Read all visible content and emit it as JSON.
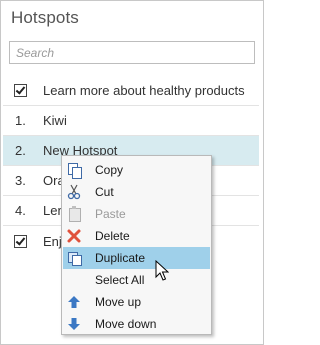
{
  "panel": {
    "title": "Hotspots",
    "search": {
      "placeholder": "Search",
      "value": ""
    }
  },
  "rows": [
    {
      "type": "check",
      "label": "Learn more about healthy products",
      "checked": true
    },
    {
      "type": "item",
      "num": "1.",
      "label": "Kiwi"
    },
    {
      "type": "item",
      "num": "2.",
      "label": "New Hotspot",
      "selected": true
    },
    {
      "type": "item",
      "num": "3.",
      "label": "Ora"
    },
    {
      "type": "item",
      "num": "4.",
      "label": "Len"
    },
    {
      "type": "check",
      "label": "Enjo",
      "checked": true
    }
  ],
  "context_menu": {
    "items": [
      {
        "label": "Copy",
        "icon": "copy-icon",
        "enabled": true
      },
      {
        "label": "Cut",
        "icon": "scissors-icon",
        "enabled": true
      },
      {
        "label": "Paste",
        "icon": "paste-icon",
        "enabled": false
      },
      {
        "label": "Delete",
        "icon": "delete-x-icon",
        "enabled": true
      },
      {
        "label": "Duplicate",
        "icon": "duplicate-icon",
        "enabled": true,
        "highlighted": true
      },
      {
        "label": "Select All",
        "icon": "",
        "enabled": true
      },
      {
        "label": "Move up",
        "icon": "arrow-up-icon",
        "enabled": true
      },
      {
        "label": "Move down",
        "icon": "arrow-down-icon",
        "enabled": true
      }
    ]
  },
  "colors": {
    "selected_row": "#d7ebf0",
    "menu_highlight": "#9fd0ea",
    "delete_icon": "#e0523c",
    "arrow_icon": "#3b78c4"
  }
}
